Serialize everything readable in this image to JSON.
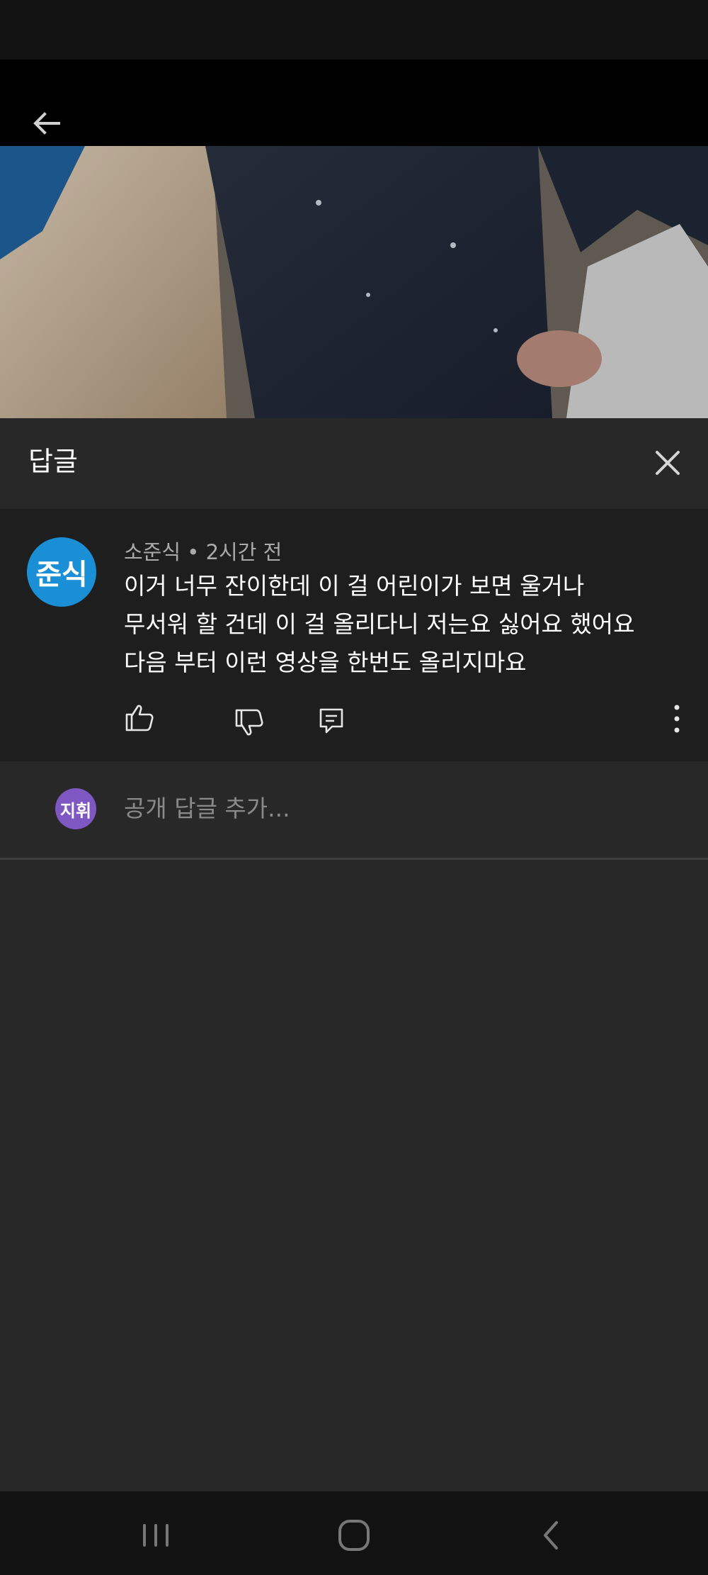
{
  "reply_panel": {
    "title": "답글",
    "comment": {
      "avatar_text": "준식",
      "avatar_color": "#1a8fd6",
      "author": "소준식",
      "separator": "•",
      "time": "2시간 전",
      "lines": [
        "이거 너무 잔이한데 이 걸 어린이가 보면 울거나",
        "무서워 할 건데 이 걸 올리다니 저는요 싫어요 했어요",
        "다음 부터 이런 영상을 한번도 올리지마요"
      ]
    },
    "reply_input": {
      "avatar_text": "지휘",
      "avatar_color": "#7e57c2",
      "placeholder": "공개 답글 추가..."
    }
  },
  "icons": {
    "back": "arrow-left-icon",
    "close": "close-icon",
    "like": "thumbs-up-icon",
    "dislike": "thumbs-down-icon",
    "reply": "comment-icon",
    "more": "more-vertical-icon",
    "nav_recent": "recent-apps-icon",
    "nav_home": "home-icon",
    "nav_back": "back-chevron-icon"
  }
}
